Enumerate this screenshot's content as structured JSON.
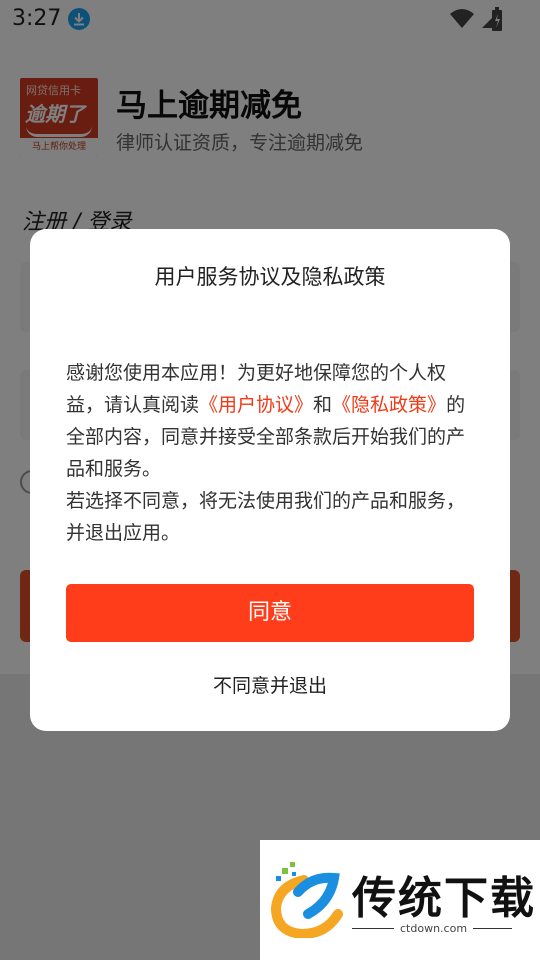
{
  "status_bar": {
    "time": "3:27"
  },
  "app": {
    "logo": {
      "top_text": "网贷信用卡",
      "mid_text": "逾期了",
      "bottom_text": "马上帮你处理"
    },
    "name": "马上逾期减免",
    "tagline": "律师认证资质，专注逾期减免"
  },
  "page": {
    "heading": "注册 / 登录"
  },
  "dialog": {
    "title": "用户服务协议及隐私政策",
    "body": {
      "p1_prefix": "感谢您使用本应用！为更好地保障您的个人权益，请认真阅读",
      "link_user_agreement": "《用户协议》",
      "p1_and": "和",
      "link_privacy_policy": "《隐私政策》",
      "p1_suffix": "的全部内容，同意并接受全部条款后开始我们的产品和服务。",
      "p2": "若选择不同意，将无法使用我们的产品和服务，并退出应用。"
    },
    "agree_label": "同意",
    "disagree_label": "不同意并退出"
  },
  "watermark": {
    "text": "传统下载",
    "url": "ctdown.com"
  },
  "colors": {
    "accent": "#ff3d1b",
    "link": "#f03a17",
    "logo_red": "#d23b20"
  }
}
